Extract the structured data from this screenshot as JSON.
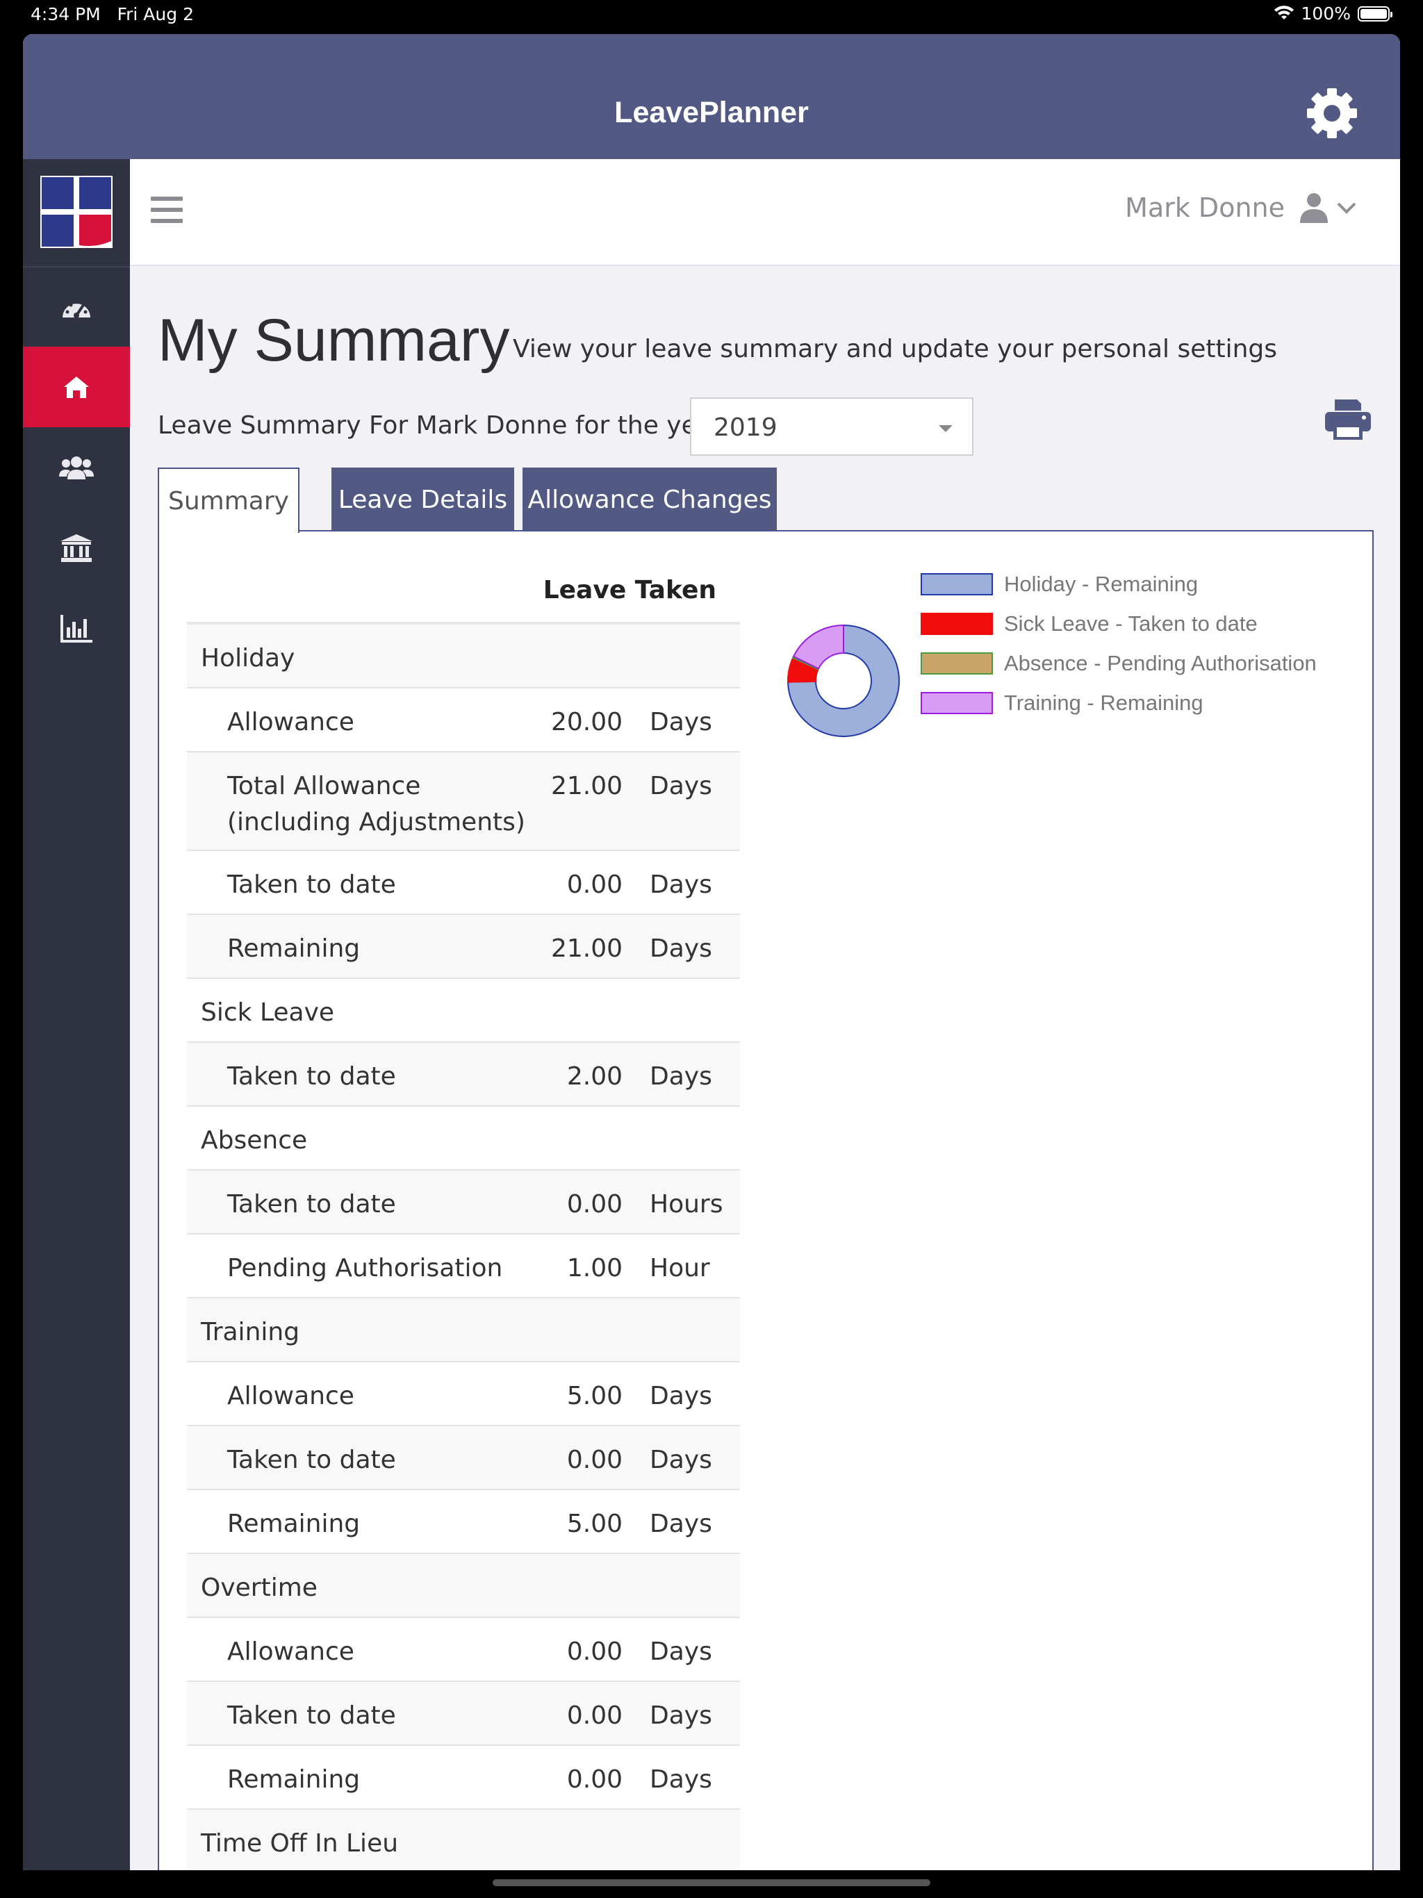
{
  "status": {
    "time": "4:34 PM",
    "date": "Fri Aug 2",
    "battery": "100%"
  },
  "app": {
    "title": "LeavePlanner"
  },
  "user": {
    "name": "Mark Donne"
  },
  "page": {
    "title": "My Summary",
    "subtitle": "View your leave summary and update your personal settings",
    "year_label": "Leave Summary For Mark Donne for the year",
    "year_value": "2019"
  },
  "tabs": [
    {
      "label": "Summary",
      "active": true
    },
    {
      "label": "Leave Details",
      "active": false
    },
    {
      "label": "Allowance Changes",
      "active": false
    }
  ],
  "table": {
    "header": "Leave Taken",
    "rows": [
      {
        "label": "Holiday",
        "type": "group"
      },
      {
        "label": "Allowance",
        "value": "20.00",
        "unit": "Days"
      },
      {
        "label": "Total Allowance",
        "label2": "(including Adjustments)",
        "value": "21.00",
        "unit": "Days"
      },
      {
        "label": "Taken to date",
        "value": "0.00",
        "unit": "Days"
      },
      {
        "label": "Remaining",
        "value": "21.00",
        "unit": "Days"
      },
      {
        "label": "Sick Leave",
        "type": "group"
      },
      {
        "label": "Taken to date",
        "value": "2.00",
        "unit": "Days"
      },
      {
        "label": "Absence",
        "type": "group"
      },
      {
        "label": "Taken to date",
        "value": "0.00",
        "unit": "Hours"
      },
      {
        "label": "Pending Authorisation",
        "value": "1.00",
        "unit": "Hour"
      },
      {
        "label": "Training",
        "type": "group"
      },
      {
        "label": "Allowance",
        "value": "5.00",
        "unit": "Days"
      },
      {
        "label": "Taken to date",
        "value": "0.00",
        "unit": "Days"
      },
      {
        "label": "Remaining",
        "value": "5.00",
        "unit": "Days"
      },
      {
        "label": "Overtime",
        "type": "group"
      },
      {
        "label": "Allowance",
        "value": "0.00",
        "unit": "Days"
      },
      {
        "label": "Taken to date",
        "value": "0.00",
        "unit": "Days"
      },
      {
        "label": "Remaining",
        "value": "0.00",
        "unit": "Days"
      },
      {
        "label": "Time Off In Lieu",
        "type": "group"
      }
    ]
  },
  "chart_data": {
    "type": "pie",
    "categories": [
      "Holiday - Remaining",
      "Sick Leave - Taken to date",
      "Absence - Pending Authorisation",
      "Training - Remaining"
    ],
    "values": [
      21,
      2,
      0.125,
      5
    ],
    "colors": [
      {
        "fill": "#9dafdb",
        "stroke": "#1f3aa6"
      },
      {
        "fill": "#f20d0d",
        "stroke": "#f20d0d"
      },
      {
        "fill": "#c9a46b",
        "stroke": "#4c9a3c"
      },
      {
        "fill": "#d99cf5",
        "stroke": "#9a1ee0"
      }
    ]
  },
  "icons": {
    "gear": "gear-icon",
    "menu": "hamburger-icon",
    "user": "user-icon",
    "chevron": "chevron-down-icon",
    "printer": "printer-icon",
    "nav": [
      "dashboard-icon",
      "home-icon",
      "users-icon",
      "bank-icon",
      "bar-chart-icon"
    ]
  }
}
